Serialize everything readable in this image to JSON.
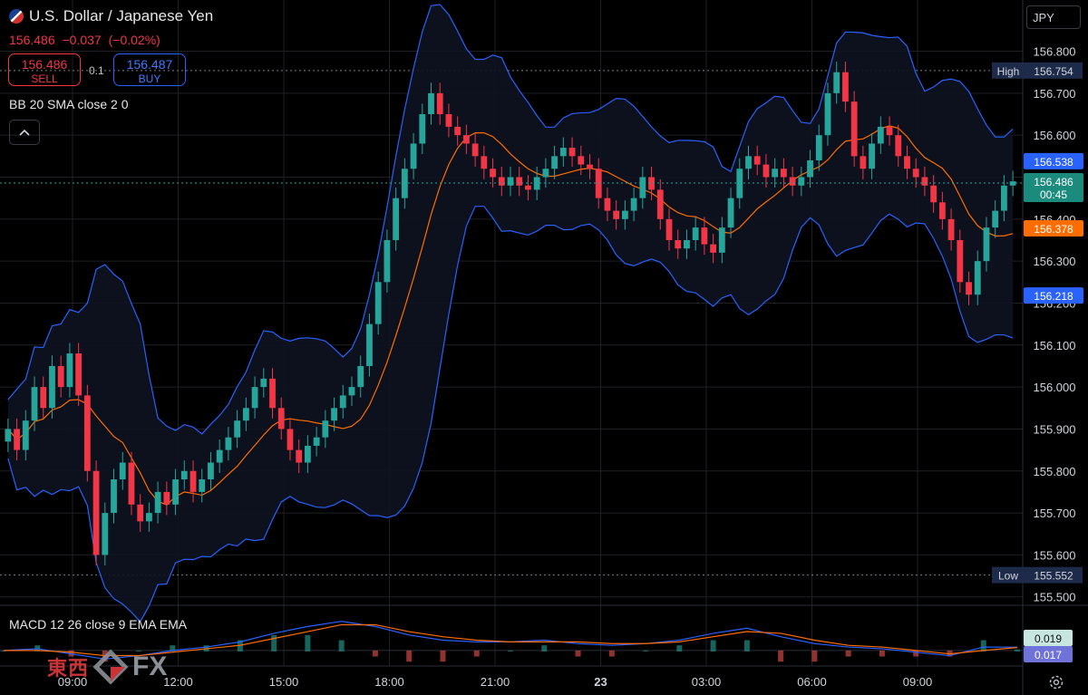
{
  "header": {
    "title": "U.S. Dollar / Japanese Yen",
    "last_price": "156.486",
    "change": "−0.037",
    "change_pct": "(−0.02%)",
    "sell_price": "156.486",
    "sell_label": "SELL",
    "buy_price": "156.487",
    "buy_label": "BUY",
    "spread": "0.1",
    "indicator_label": "BB 20 SMA close 2 0",
    "currency": "JPY",
    "flag_icon": "us-japan-flag-icon",
    "collapse_icon": "chevron-up-icon"
  },
  "macd": {
    "label": "MACD 12 26 close 9 EMA EMA",
    "macd_value": "0.019",
    "signal_value": "0.017"
  },
  "logo": {
    "kanji": "東西",
    "fx": "FX"
  },
  "colors": {
    "up": "#26a69a",
    "down": "#f23645",
    "bb": "#2962ff",
    "sma": "#ff6d00",
    "grid": "#1e2026",
    "bg": "#000000",
    "text": "#d1d4dc"
  },
  "chart_data": {
    "type": "candlestick",
    "instrument": "U.S. Dollar / Japanese Yen",
    "y_ticks": [
      "156.800",
      "156.700",
      "156.600",
      "156.500",
      "156.400",
      "156.300",
      "156.200",
      "156.100",
      "156.000",
      "155.900",
      "155.800",
      "155.700",
      "155.600",
      "155.500"
    ],
    "ylim": [
      155.48,
      156.84
    ],
    "x_ticks": [
      "09:00",
      "12:00",
      "15:00",
      "18:00",
      "21:00",
      "23",
      "03:00",
      "06:00",
      "09:00"
    ],
    "high": {
      "label": "High",
      "value": 156.754,
      "text": "156.754"
    },
    "low": {
      "label": "Low",
      "value": 155.552,
      "text": "155.552"
    },
    "last": {
      "value": 156.486,
      "text": "156.486",
      "countdown": "00:45"
    },
    "bb_upper": {
      "value": 156.538,
      "text": "156.538"
    },
    "bb_basis": {
      "value": 156.378,
      "text": "156.378"
    },
    "bb_lower": {
      "value": 156.218,
      "text": "156.218"
    },
    "closes": [
      155.9,
      155.85,
      155.92,
      156.0,
      155.95,
      156.05,
      156.0,
      156.08,
      155.98,
      155.8,
      155.6,
      155.7,
      155.78,
      155.82,
      155.72,
      155.68,
      155.7,
      155.75,
      155.72,
      155.78,
      155.8,
      155.75,
      155.78,
      155.82,
      155.85,
      155.88,
      155.92,
      155.95,
      156.0,
      156.02,
      155.95,
      155.9,
      155.85,
      155.82,
      155.86,
      155.88,
      155.92,
      155.95,
      155.98,
      156.0,
      156.05,
      156.15,
      156.25,
      156.35,
      156.45,
      156.52,
      156.58,
      156.65,
      156.7,
      156.65,
      156.62,
      156.6,
      156.58,
      156.55,
      156.52,
      156.5,
      156.48,
      156.5,
      156.48,
      156.47,
      156.5,
      156.52,
      156.55,
      156.57,
      156.55,
      156.53,
      156.52,
      156.45,
      156.42,
      156.4,
      156.42,
      156.45,
      156.5,
      156.47,
      156.4,
      156.35,
      156.33,
      156.35,
      156.38,
      156.34,
      156.32,
      156.38,
      156.45,
      156.52,
      156.55,
      156.53,
      156.5,
      156.52,
      156.5,
      156.48,
      156.5,
      156.54,
      156.6,
      156.7,
      156.75,
      156.68,
      156.55,
      156.52,
      156.58,
      156.62,
      156.6,
      156.55,
      156.52,
      156.5,
      156.48,
      156.44,
      156.4,
      156.35,
      156.25,
      156.22,
      156.3,
      156.38,
      156.42,
      156.48,
      156.49
    ],
    "macd_line": [
      0.0,
      0.01,
      -0.02,
      -0.05,
      -0.03,
      0.0,
      0.02,
      0.05,
      0.1,
      0.14,
      0.17,
      0.14,
      0.09,
      0.06,
      0.05,
      0.05,
      0.06,
      0.04,
      0.03,
      0.04,
      0.06,
      0.1,
      0.13,
      0.08,
      0.04,
      0.02,
      0.01,
      -0.01,
      -0.03,
      0.02,
      0.019
    ],
    "signal_line": [
      0.0,
      0.0,
      -0.01,
      -0.03,
      -0.03,
      -0.01,
      0.01,
      0.03,
      0.07,
      0.11,
      0.15,
      0.15,
      0.11,
      0.08,
      0.06,
      0.05,
      0.05,
      0.05,
      0.04,
      0.04,
      0.05,
      0.08,
      0.11,
      0.1,
      0.06,
      0.03,
      0.02,
      0.0,
      -0.02,
      0.0,
      0.017
    ]
  }
}
